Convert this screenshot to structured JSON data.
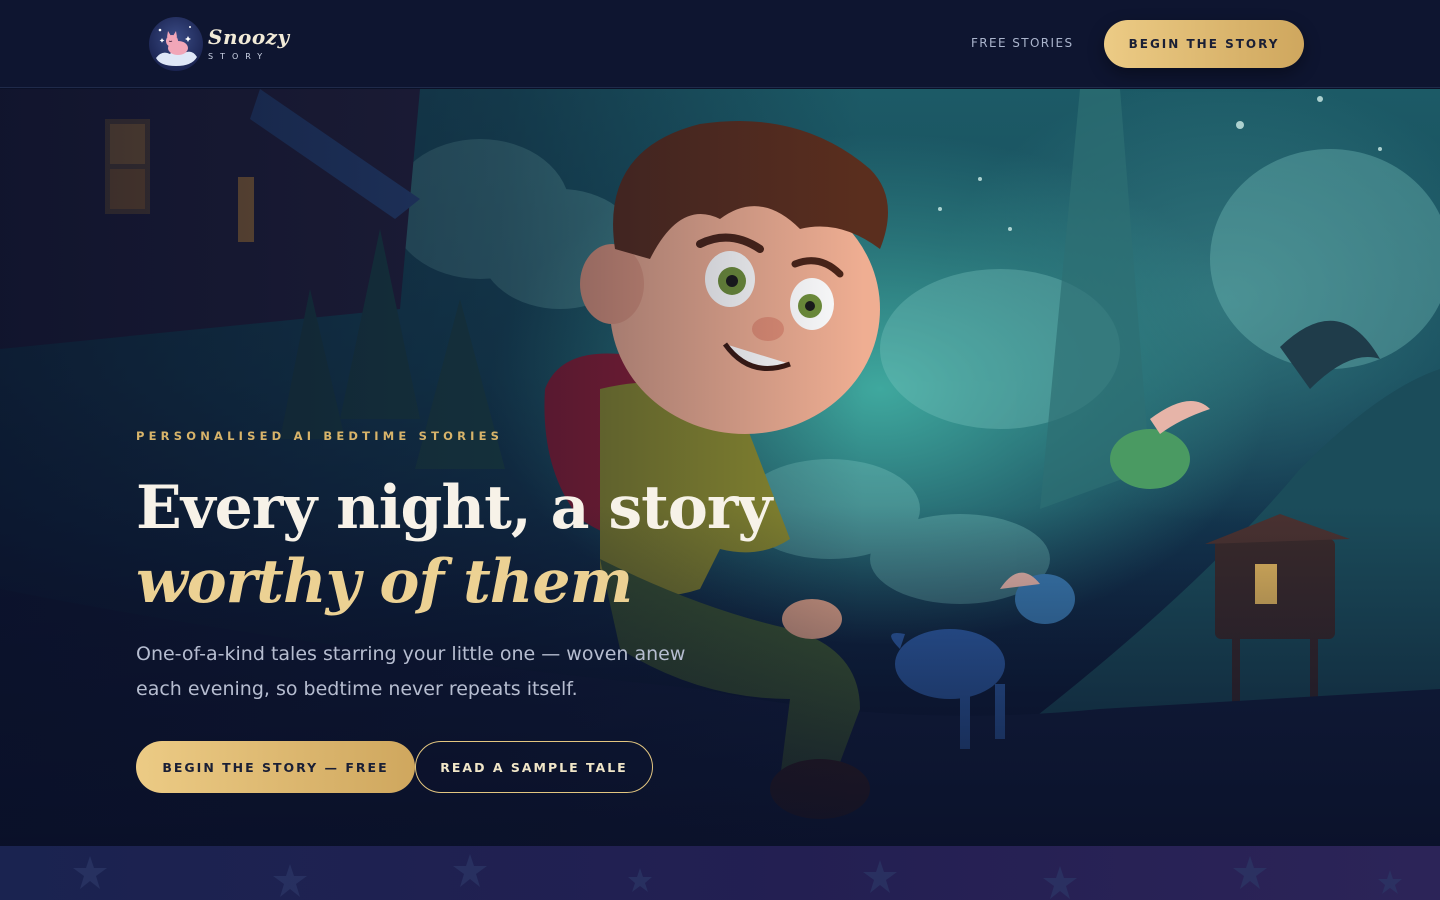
{
  "header": {
    "logo": {
      "name": "Snoozy",
      "sub": "STORY"
    },
    "nav_link": "FREE STORIES",
    "cta_label": "BEGIN THE STORY"
  },
  "hero": {
    "eyebrow": "PERSONALISED AI BEDTIME STORIES",
    "headline_line1": "Every night, a story",
    "headline_line2": "worthy of them",
    "subtext": "One-of-a-kind tales starring your little one — woven anew each evening, so bedtime never repeats itself.",
    "primary_cta": "BEGIN THE STORY — FREE",
    "secondary_cta": "READ A SAMPLE TALE"
  },
  "colors": {
    "background": "#0b1128",
    "header": "#0e1530",
    "gold_accent": "#e3c680",
    "gold_button": "#eccb85",
    "headline": "#f7f2e8",
    "headline_accent": "#ecd193",
    "eyebrow": "#d8b46a"
  },
  "icons": {
    "logo": "sleeping-cat-moon-icon",
    "decor": "star-icon"
  }
}
